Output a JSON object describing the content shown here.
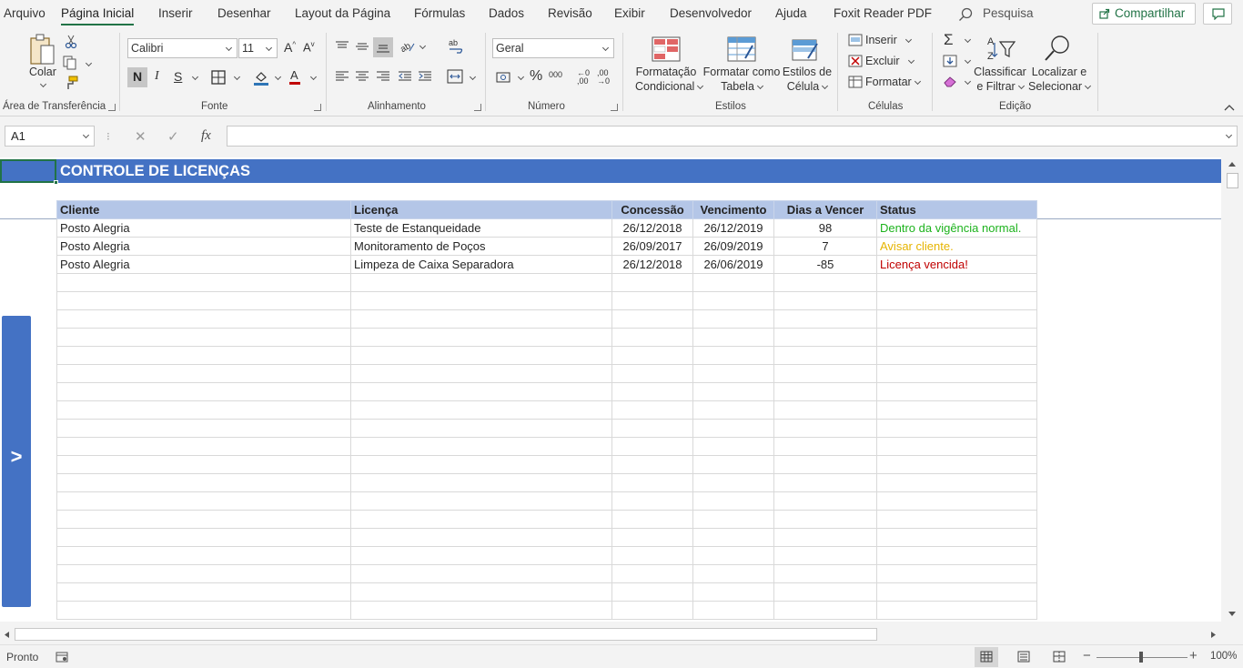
{
  "menu": {
    "tabs": [
      "Arquivo",
      "Página Inicial",
      "Inserir",
      "Desenhar",
      "Layout da Página",
      "Fórmulas",
      "Dados",
      "Revisão",
      "Exibir",
      "Desenvolvedor",
      "Ajuda",
      "Foxit Reader PDF"
    ],
    "active_tab": "Página Inicial",
    "search_label": "Pesquisa",
    "share_label": "Compartilhar"
  },
  "ribbon": {
    "clipboard": {
      "paste_label": "Colar",
      "group_label": "Área de Transferência"
    },
    "font": {
      "name": "Calibri",
      "size": "11",
      "bold": "N",
      "italic": "I",
      "underline": "S",
      "group_label": "Fonte"
    },
    "alignment": {
      "group_label": "Alinhamento"
    },
    "number": {
      "format": "Geral",
      "group_label": "Número"
    },
    "styles": {
      "conditional_1": "Formatação",
      "conditional_2": "Condicional",
      "table_1": "Formatar como",
      "table_2": "Tabela",
      "cell_1": "Estilos de",
      "cell_2": "Célula",
      "group_label": "Estilos"
    },
    "cells": {
      "insert": "Inserir",
      "delete": "Excluir",
      "format": "Formatar",
      "group_label": "Células"
    },
    "editing": {
      "sort_1": "Classificar",
      "sort_2": "e Filtrar",
      "find_1": "Localizar e",
      "find_2": "Selecionar",
      "group_label": "Edição"
    }
  },
  "formula_bar": {
    "name_box": "A1",
    "value": ""
  },
  "sheet": {
    "title": "CONTROLE DE LICENÇAS",
    "columns": [
      "Cliente",
      "Licença",
      "Concessão",
      "Vencimento",
      "Dias a Vencer",
      "Status"
    ],
    "rows": [
      {
        "cliente": "Posto Alegria",
        "licenca": "Teste de Estanqueidade",
        "concessao": "26/12/2018",
        "vencimento": "26/12/2019",
        "dias": "98",
        "status": "Dentro da vigência normal.",
        "status_color": "#1db31d"
      },
      {
        "cliente": "Posto Alegria",
        "licenca": "Monitoramento de Poços",
        "concessao": "26/09/2017",
        "vencimento": "26/09/2019",
        "dias": "7",
        "status": "Avisar cliente.",
        "status_color": "#e6b400"
      },
      {
        "cliente": "Posto Alegria",
        "licenca": "Limpeza de Caixa Separadora",
        "concessao": "26/12/2018",
        "vencimento": "26/06/2019",
        "dias": "-85",
        "status": "Licença vencida!",
        "status_color": "#c00000"
      }
    ],
    "side_button_label": ">",
    "header_color": "#4472c4",
    "column_header_color": "#b4c6e7"
  },
  "status_bar": {
    "ready": "Pronto",
    "zoom": "100%"
  }
}
